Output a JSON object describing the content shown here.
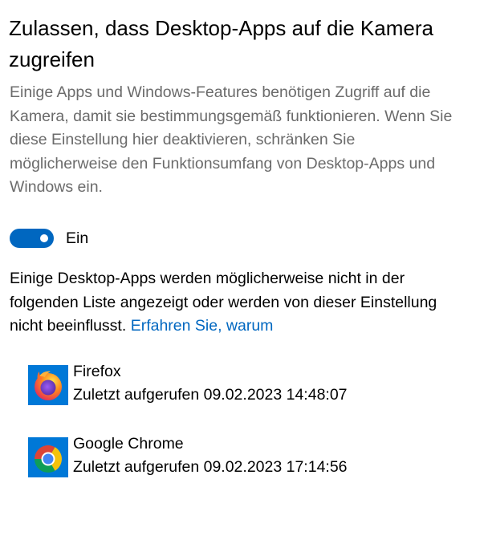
{
  "title": "Zulassen, dass Desktop-Apps auf die Kamera zugreifen",
  "description": "Einige Apps und Windows-Features benötigen Zugriff auf die Kamera, damit sie bestimmungsgemäß funktionieren. Wenn Sie diese Einstellung hier deaktivieren, schränken Sie möglicherweise den Funktionsumfang von Desktop-Apps und Windows ein.",
  "toggle": {
    "state": "on",
    "label": "Ein"
  },
  "info": {
    "text": "Einige Desktop-Apps werden möglicherweise nicht in der folgenden Liste angezeigt oder werden von dieser Einstellung nicht beeinflusst.",
    "link_label": "Erfahren Sie, warum"
  },
  "apps": [
    {
      "name": "Firefox",
      "last_accessed": "Zuletzt aufgerufen 09.02.2023 14:48:07",
      "icon": "firefox-icon"
    },
    {
      "name": "Google Chrome",
      "last_accessed": "Zuletzt aufgerufen 09.02.2023 17:14:56",
      "icon": "chrome-icon"
    }
  ],
  "colors": {
    "accent": "#0067c0",
    "icon_tile": "#0078d7",
    "secondary_text": "#6b6b6b"
  }
}
